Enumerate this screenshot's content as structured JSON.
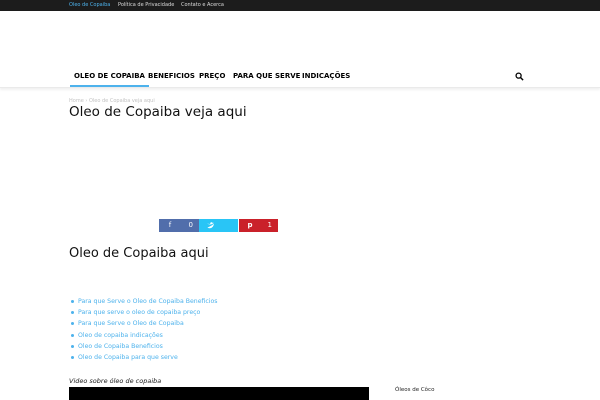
{
  "topbar": {
    "links": [
      "Oleo de Copaiba",
      "Política de Privacidade",
      "Contato e Acerca"
    ]
  },
  "nav": {
    "items": [
      "OLEO DE COPAIBA",
      "BENEFICIOS",
      "PREÇO",
      "PARA QUE SERVE",
      "INDICAÇÕES"
    ]
  },
  "breadcrumb": {
    "home": "Home",
    "sep": "›",
    "current": "Oleo de Copaiba veja aqui"
  },
  "post": {
    "title": "Oleo de Copaiba veja aqui"
  },
  "share": {
    "facebook_count": "0",
    "pinterest_count": "1",
    "colors": {
      "facebook": "#516eab",
      "twitter": "#29c5f6",
      "pinterest": "#ca212a"
    }
  },
  "content": {
    "heading": "Oleo de Copaiba aqui",
    "links": [
      "Para que Serve o Oleo de Copaiba Beneficios",
      "Para que serve o oleo de copaiba preço",
      "Para que Serve o Oleo de Copaiba",
      "Oleo de copaiba indicações",
      "Oleo de Copaiba Beneficios",
      "Oleo de Copaiba para que serve"
    ],
    "video_caption": "Video sobre óleo de copaiba"
  },
  "sidebar": {
    "title": "Óleos de Côco"
  },
  "accent_color": "#4db2ec"
}
